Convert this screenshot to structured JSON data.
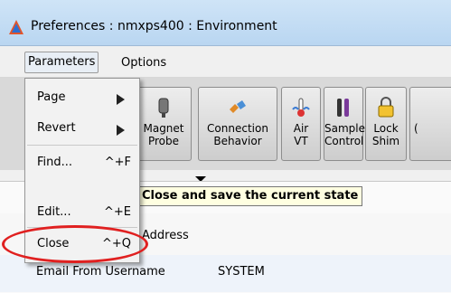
{
  "window": {
    "title": "Preferences : nmxps400 : Environment",
    "icon": "app-logo-icon"
  },
  "menubar": {
    "parameters": "Parameters",
    "options": "Options"
  },
  "toolbar": {
    "buttons": [
      {
        "line1": "Magnet",
        "line2": "Probe",
        "icon": "magnet-probe-icon"
      },
      {
        "line1": "Connection",
        "line2": "Behavior",
        "icon": "connection-icon"
      },
      {
        "line1": "Air",
        "line2": "VT",
        "icon": "thermometer-icon"
      },
      {
        "line1": "Sample",
        "line2": "Control",
        "icon": "sample-tubes-icon"
      },
      {
        "line1": "Lock",
        "line2": "Shim",
        "icon": "auto-lock-icon"
      },
      {
        "line1": "(",
        "line2": "",
        "icon": "partial-icon"
      }
    ]
  },
  "dropdown": {
    "items": [
      {
        "label": "Page",
        "shortcut": "",
        "submenu": true
      },
      {
        "label": "Revert",
        "shortcut": "",
        "submenu": true
      },
      {
        "label": "Find...",
        "shortcut": "^+F",
        "submenu": false
      },
      {
        "label": "Edit...",
        "shortcut": "^+E",
        "submenu": false
      },
      {
        "label": "Close",
        "shortcut": "^+Q",
        "submenu": false
      }
    ]
  },
  "tooltip": {
    "text": "Close and save the current state"
  },
  "content": {
    "address_label": "Address",
    "email_label": "Email From Username",
    "email_value": "SYSTEM"
  },
  "colors": {
    "annotation": "#e02020",
    "tooltip_bg": "#ffffe1",
    "titlebar": "#cfe4f7"
  }
}
